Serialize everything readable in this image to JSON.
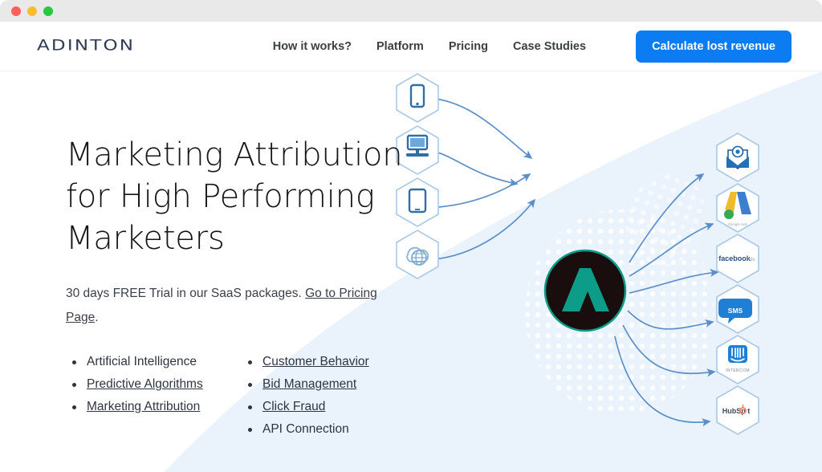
{
  "window": {
    "traffic_lights": [
      "close",
      "minimize",
      "maximize"
    ],
    "colors": {
      "close": "#ff5f57",
      "minimize": "#febc2e",
      "maximize": "#28c840"
    }
  },
  "header": {
    "logo_text": "ADINTON",
    "logo_color": "#2f3b55",
    "nav": [
      {
        "label": "How it works?",
        "name": "nav-how-it-works"
      },
      {
        "label": "Platform",
        "name": "nav-platform"
      },
      {
        "label": "Pricing",
        "name": "nav-pricing"
      },
      {
        "label": "Case Studies",
        "name": "nav-case-studies"
      }
    ],
    "cta": {
      "label": "Calculate lost revenue",
      "color": "#0c7cf2"
    }
  },
  "hero": {
    "title_line1": "Marketing Attribution",
    "title_line2": "for High Performing",
    "title_line3": "Marketers",
    "subtitle_text": "30 days FREE Trial in our SaaS packages. ",
    "subtitle_link": "Go to Pricing Page",
    "subtitle_end": ".",
    "bg_accent": "#eaf3fb",
    "features_left": [
      {
        "label": "Artificial Intelligence",
        "link": false
      },
      {
        "label": "Predictive Algorithms",
        "link": true
      },
      {
        "label": "Marketing Attribution",
        "link": true
      }
    ],
    "features_right": [
      {
        "label": "Customer Behavior",
        "link": true
      },
      {
        "label": "Bid Management",
        "link": true
      },
      {
        "label": "Click Fraud",
        "link": true
      },
      {
        "label": "API Connection",
        "link": false
      }
    ]
  },
  "graphic": {
    "hub": {
      "name": "adinton-hub-logo",
      "circle_color": "#190d0d",
      "mark_color": "#0c9c87"
    },
    "sources": [
      {
        "name": "mobile-phone-icon",
        "label": "Mobile"
      },
      {
        "name": "desktop-computer-icon",
        "label": "Desktop"
      },
      {
        "name": "tablet-icon",
        "label": "Tablet"
      },
      {
        "name": "cloud-globe-icon",
        "label": "Web"
      }
    ],
    "destinations": [
      {
        "name": "email-icon",
        "label": "Email"
      },
      {
        "name": "google-ads-icon",
        "label": "Google Ads"
      },
      {
        "name": "facebook-ads-icon",
        "label": "facebook Ads"
      },
      {
        "name": "sms-icon",
        "label": "SMS"
      },
      {
        "name": "intercom-icon",
        "label": "INTERCOM"
      },
      {
        "name": "hubspot-icon",
        "label": "HubSpot"
      }
    ],
    "arrow_color": "#5b8fc9"
  }
}
